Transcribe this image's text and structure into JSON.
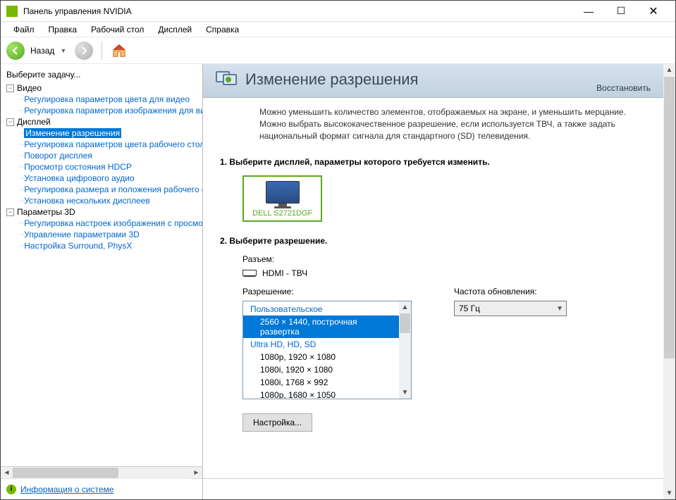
{
  "window": {
    "title": "Панель управления NVIDIA"
  },
  "menubar": {
    "file": "Файл",
    "edit": "Правка",
    "desktop": "Рабочий стол",
    "display": "Дисплей",
    "help": "Справка"
  },
  "toolbar": {
    "back_label": "Назад"
  },
  "sidebar": {
    "task_header": "Выберите задачу...",
    "nodes": [
      {
        "label": "Видео",
        "type": "category"
      },
      {
        "label": "Регулировка параметров цвета для видео",
        "type": "link",
        "indent": 2
      },
      {
        "label": "Регулировка параметров изображения для видео",
        "type": "link",
        "indent": 2
      },
      {
        "label": "Дисплей",
        "type": "category"
      },
      {
        "label": "Изменение разрешения",
        "type": "link",
        "indent": 2,
        "selected": true
      },
      {
        "label": "Регулировка параметров цвета рабочего стола",
        "type": "link",
        "indent": 2
      },
      {
        "label": "Поворот дисплея",
        "type": "link",
        "indent": 2
      },
      {
        "label": "Просмотр состояния HDCP",
        "type": "link",
        "indent": 2
      },
      {
        "label": "Установка цифрового аудио",
        "type": "link",
        "indent": 2
      },
      {
        "label": "Регулировка размера и положения рабочего стола",
        "type": "link",
        "indent": 2
      },
      {
        "label": "Установка нескольких дисплеев",
        "type": "link",
        "indent": 2
      },
      {
        "label": "Параметры 3D",
        "type": "category"
      },
      {
        "label": "Регулировка настроек изображения с просмотром",
        "type": "link",
        "indent": 2
      },
      {
        "label": "Управление параметрами 3D",
        "type": "link",
        "indent": 2
      },
      {
        "label": "Настройка Surround, PhysX",
        "type": "link",
        "indent": 2
      }
    ],
    "info_link": "Информация о системе"
  },
  "page": {
    "title": "Изменение разрешения",
    "restore": "Восстановить",
    "description": "Можно уменьшить количество элементов, отображаемых на экране, и уменьшить мерцание. Можно выбрать высококачественное разрешение, если используется ТВЧ, а также задать национальный формат сигнала для стандартного (SD) телевидения.",
    "section1_title": "1. Выберите дисплей, параметры которого требуется изменить.",
    "monitor_name": "DELL S2721DGF",
    "section2_title": "2. Выберите разрешение.",
    "connector_label": "Разъем:",
    "connector_value": "HDMI - ТВЧ",
    "resolution_label": "Разрешение:",
    "res_group_custom": "Пользовательское",
    "res_selected": "2560 × 1440, построчная развертка",
    "res_group_uhd": "Ultra HD, HD, SD",
    "res_items": [
      "1080p, 1920 × 1080",
      "1080i, 1920 × 1080",
      "1080i, 1768 × 992",
      "1080p, 1680 × 1050"
    ],
    "refresh_label": "Частота обновления:",
    "refresh_value": "75 Гц",
    "customize_button": "Настройка..."
  }
}
